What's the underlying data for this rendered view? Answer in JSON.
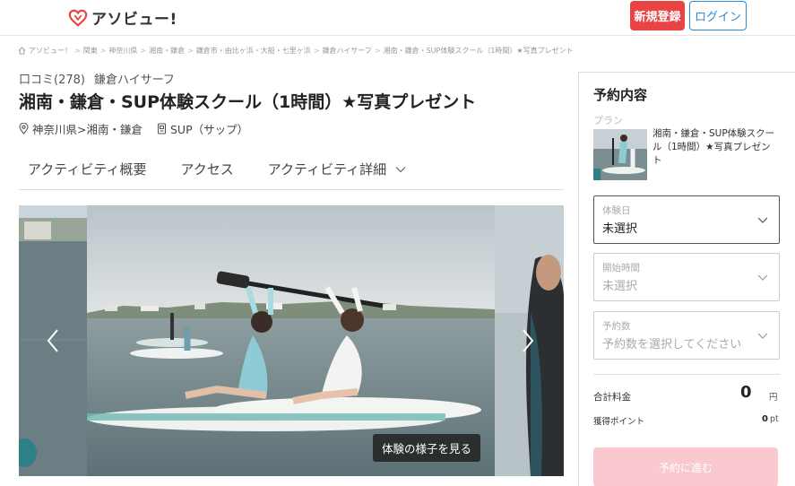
{
  "header": {
    "logo_text": "アソビュー!",
    "register_label": "新規登録",
    "login_label": "ログイン"
  },
  "breadcrumb": [
    "アソビュー！",
    "関東",
    "神奈川県",
    "湘南・鎌倉",
    "鎌倉市・由比ヶ浜・大船・七里ヶ浜",
    "鎌倉ハイサーフ",
    "湘南・鎌倉・SUP体験スクール（1時間）★写真プレゼント"
  ],
  "activity": {
    "review_text": "口コミ(278)",
    "provider": "鎌倉ハイサーフ",
    "title": "湘南・鎌倉・SUP体験スクール（1時間）★写真プレゼント",
    "location": "神奈川県>湘南・鎌倉",
    "category": "SUP（サップ）"
  },
  "tabs": [
    {
      "label": "アクティビティ概要"
    },
    {
      "label": "アクセス"
    },
    {
      "label": "アクティビティ詳細"
    }
  ],
  "carousel": {
    "photo_button_label": "体験の様子を見る"
  },
  "reservation": {
    "title": "予約内容",
    "plan_label": "プラン",
    "plan_name": "湘南・鎌倉・SUP体験スクール（1時間）★写真プレゼント",
    "date_label": "体験日",
    "date_value": "未選択",
    "time_label": "開始時間",
    "time_value": "未選択",
    "count_label": "予約数",
    "count_placeholder": "予約数を選択してください",
    "total_label": "合計料金",
    "total_value": "0",
    "total_unit": "円",
    "points_label": "獲得ポイント",
    "points_value": "0",
    "points_unit": "pt",
    "proceed_label": "予約に進む"
  },
  "colors": {
    "accent_red": "#e94444",
    "link_blue": "#2a8ad6",
    "proceed_disabled": "#f9c9cf"
  }
}
